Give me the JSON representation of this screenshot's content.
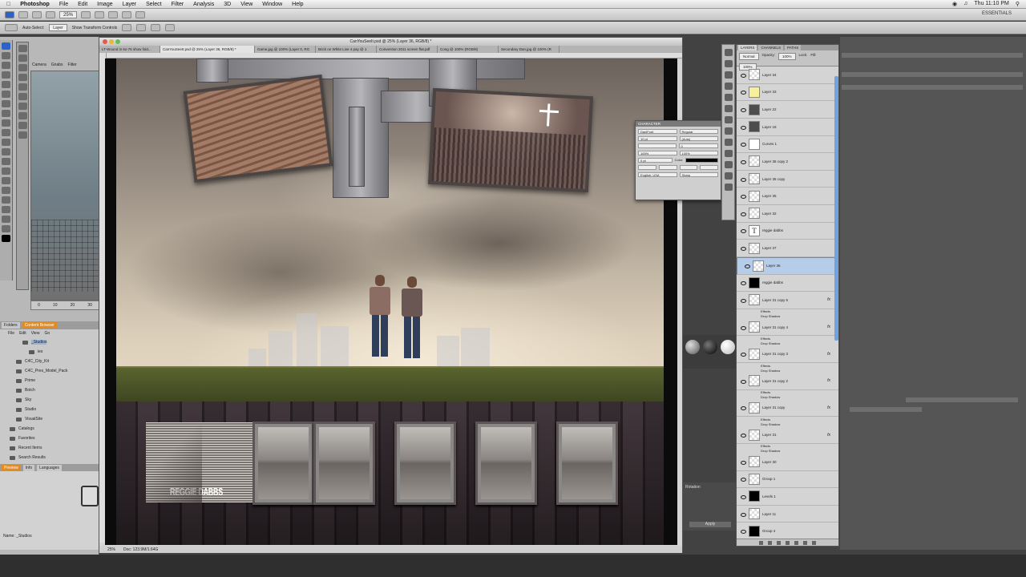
{
  "menubar": {
    "apple": "",
    "app_name": "Photoshop",
    "items": [
      "File",
      "Edit",
      "Image",
      "Layer",
      "Select",
      "Filter",
      "Analysis",
      "3D",
      "View",
      "Window",
      "Help"
    ],
    "clock": "Thu 11:10 PM"
  },
  "appbar": {
    "zoom": "25%",
    "workspace": "ESSENTIALS"
  },
  "options_bar": {
    "auto_select": "Auto-Select:",
    "auto_select_value": "Layer",
    "transform_controls": "Show Transform Controls"
  },
  "bridge": {
    "top_tabs": [
      "Camera",
      "Gnabs",
      "Filter"
    ],
    "tabs": [
      "Folders",
      "Content Browser"
    ],
    "active_tab": "Content Browser",
    "columns": [
      "File",
      "Edit",
      "View",
      "Go"
    ],
    "folders": [
      "_Studios",
      "ies",
      "C4C_City_Kit",
      "C4C_Pres_Model_Pack",
      "Prime",
      "Botch",
      "Sky",
      "Studio",
      "VisualSite",
      "Catalogs",
      "Favorites",
      "Recent Items",
      "Search Results"
    ],
    "preview_tabs": [
      "Preview",
      "Info",
      "Languages"
    ],
    "name_label": "Name: _Studios",
    "ruler_ticks": [
      "0",
      "10",
      "20",
      "30"
    ]
  },
  "document": {
    "title": "CanYouSeeIt.psd @ 25% (Layer 36, RGB/8) *",
    "tabs": [
      "LT-Wound in 6x-76 show fold...",
      "CanYouSeeIt.psd @ 25% (Layer 36, RGB/8) *",
      "Game.jpg @ 100% (Layer 0, RG",
      "Brick on White Live 4 pay @ 1",
      "Convention 2011 screen flat.pdf",
      "Cong @ 100% (RGB/8)",
      "Secondary Dan.jpg @ 100% (R"
    ],
    "active_tab": 1,
    "status_zoom": "25%",
    "status_doc": "Doc: 123.9M/1.64G"
  },
  "artwork": {
    "album_title": "REGGIE DABBS"
  },
  "character_panel": {
    "title": "CHARACTER",
    "font_family": "DaniFont",
    "font_style": "Regular",
    "size": "10 pt",
    "leading": "(Auto)",
    "tracking": "0",
    "scale_v": "100%",
    "scale_h": "100%",
    "baseline": "0 pt",
    "color_label": "Color:",
    "language": "English: USA",
    "antialias": "Sharp"
  },
  "layers_panel": {
    "tabs": [
      "LAYERS",
      "CHANNELS",
      "PATHS"
    ],
    "blend_mode": "Normal",
    "opacity_label": "Opacity:",
    "opacity": "100%",
    "lock_label": "Lock:",
    "fill_label": "Fill:",
    "fill": "100%",
    "layers": [
      {
        "name": "Layer 34",
        "thumb": "trans"
      },
      {
        "name": "Layer 33",
        "thumb": "yellow"
      },
      {
        "name": "Layer 22",
        "thumb": "dkgray"
      },
      {
        "name": "Layer 18",
        "thumb": "dkgray"
      },
      {
        "name": "Curves 1",
        "thumb": "mask"
      },
      {
        "name": "Layer 36 copy 2",
        "thumb": "trans"
      },
      {
        "name": "Layer 36 copy",
        "thumb": "trans"
      },
      {
        "name": "Layer 35",
        "thumb": "trans"
      },
      {
        "name": "Layer 32",
        "thumb": "trans"
      },
      {
        "name": "reggie dabbs",
        "thumb": "text"
      },
      {
        "name": "Layer 37",
        "thumb": "trans"
      },
      {
        "name": "Layer 36",
        "thumb": "trans",
        "selected": true
      },
      {
        "name": "reggie dabbs",
        "thumb": "black"
      },
      {
        "name": "Layer 31 copy 5",
        "thumb": "trans",
        "fx": true
      },
      {
        "name": "Layer 31 copy 4",
        "thumb": "trans",
        "fx": true
      },
      {
        "name": "Layer 31 copy 3",
        "thumb": "trans",
        "fx": true
      },
      {
        "name": "Layer 31 copy 2",
        "thumb": "trans",
        "fx": true
      },
      {
        "name": "Layer 31 copy",
        "thumb": "trans",
        "fx": true
      },
      {
        "name": "Layer 31",
        "thumb": "trans",
        "fx": true
      },
      {
        "name": "Layer 30",
        "thumb": "trans"
      },
      {
        "name": "Group 1",
        "thumb": "trans"
      },
      {
        "name": "Levels 1",
        "thumb": "black"
      },
      {
        "name": "Layer 11",
        "thumb": "trans"
      },
      {
        "name": "Group 4",
        "thumb": "black"
      }
    ],
    "effects_label": "Effects",
    "drop_shadow_label": "Drop Shadow"
  },
  "rotation_panel": {
    "title": "Rotation",
    "apply": "Apply"
  },
  "colors": {
    "selection": "#b6cdea",
    "active_orange": "#e08b24",
    "blue_tool": "#2d63c8"
  }
}
